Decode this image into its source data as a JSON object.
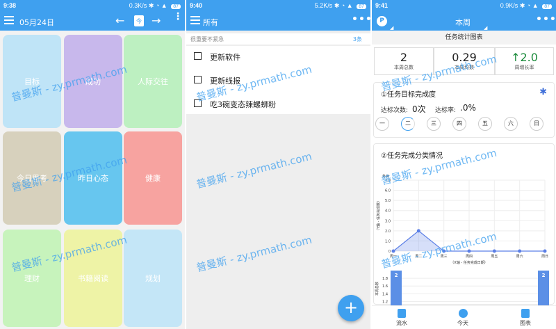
{
  "panel1": {
    "status": {
      "time": "9:38",
      "net": "0.3K/s",
      "battery": "87"
    },
    "date": "05月24日",
    "calendar_day": "今",
    "tiles": [
      {
        "label": "目标",
        "color": "#bfe4f7"
      },
      {
        "label": "成功",
        "color": "#c8b8ec"
      },
      {
        "label": "人际交往",
        "color": "#bdf0c1"
      },
      {
        "label": "今日思考",
        "color": "#d7d1bd"
      },
      {
        "label": "昨日心态",
        "color": "#67c6ef"
      },
      {
        "label": "健康",
        "color": "#f7a3a0"
      },
      {
        "label": "理财",
        "color": "#c7f3bc"
      },
      {
        "label": "书籍阅读",
        "color": "#eef3a6"
      },
      {
        "label": "规划",
        "color": "#c4e6f7"
      }
    ]
  },
  "panel2": {
    "status": {
      "time": "9:40",
      "net": "5.2K/s",
      "battery": "87"
    },
    "title": "所有",
    "group": {
      "label": "很重要不紧急",
      "count": "3条"
    },
    "tasks": [
      "更新软件",
      "更新线报",
      "吃3碗变态辣螺蛳粉"
    ],
    "fab": "+"
  },
  "panel3": {
    "status": {
      "time": "9:41",
      "net": "0.9K/s",
      "battery": "87"
    },
    "title": "本周",
    "section_header": "任务统计图表",
    "stats": [
      {
        "value": "2",
        "label": "本周总数"
      },
      {
        "value": "0.29",
        "label": "本周均数"
      },
      {
        "value": "↑2.0",
        "label": "周增长率"
      }
    ],
    "goal_title": "①任务目标完成度",
    "reached_label": "达标次数:",
    "reached_value": "0次",
    "rate_label": "达标率:",
    "rate_value": ".0%",
    "days": [
      "一",
      "二",
      "三",
      "四",
      "五",
      "六",
      "日"
    ],
    "chart_title": "②任务完成分类情况",
    "bottom_nav": [
      "流水",
      "今天",
      "图表"
    ]
  },
  "watermark": "普曼斯 - zy.prmath.com",
  "chart_data": [
    {
      "type": "area",
      "title": "",
      "ylabel": "（Y轴 - 任务完成数）",
      "xlabel": "（X轴 - 任务完成日期）",
      "legend": "条目",
      "categories": [
        "周一",
        "周二",
        "周三",
        "周四",
        "周五",
        "周六",
        "周日"
      ],
      "values": [
        0,
        2,
        0,
        0,
        0,
        0,
        0
      ],
      "yticks": [
        "7.0",
        "6.0",
        "5.0",
        "4.0",
        "3.0",
        "2.0",
        "1.0",
        "0"
      ],
      "ylim": [
        0,
        7
      ],
      "color": "#5b7fe6"
    },
    {
      "type": "bar",
      "ylabel": "本周总数",
      "yticks": [
        "1.8",
        "1.6",
        "1.4",
        "1.2"
      ],
      "values": [
        2,
        2
      ],
      "labels": [
        "2",
        "2"
      ],
      "color": "#5b8fe6"
    }
  ]
}
